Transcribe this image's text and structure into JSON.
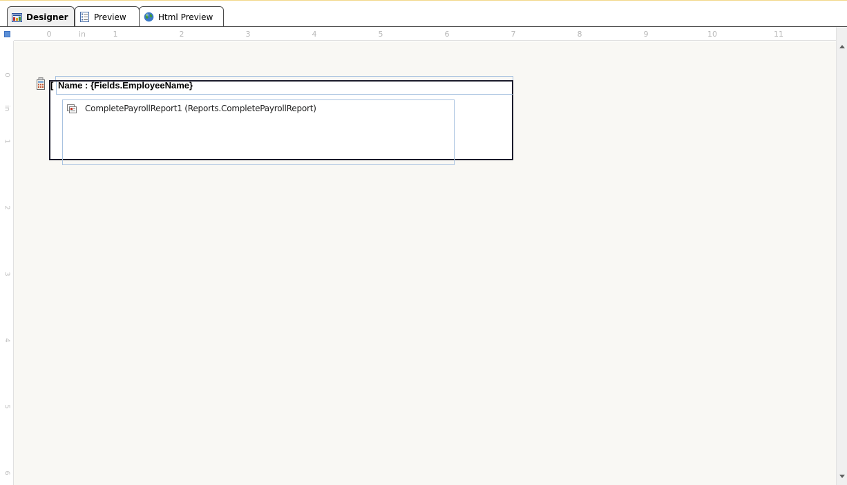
{
  "tabs": [
    {
      "label": "Designer",
      "icon": "designer-icon",
      "active": true
    },
    {
      "label": "Preview",
      "icon": "preview-icon",
      "active": false
    },
    {
      "label": "Html Preview",
      "icon": "globe-icon",
      "active": false
    }
  ],
  "ruler": {
    "unit": "in",
    "horizontal_labels": [
      "0",
      "1",
      "2",
      "3",
      "4",
      "5",
      "6",
      "7",
      "8",
      "9",
      "10",
      "11"
    ],
    "vertical_labels": [
      "0",
      "in",
      "1",
      "2",
      "3",
      "4",
      "5",
      "6"
    ]
  },
  "report": {
    "group_header_text": "Name : {Fields.EmployeeName}",
    "group_bracket": "[",
    "subreport_text": "CompletePayrollReport1 (Reports.CompletePayrollReport)"
  },
  "colors": {
    "accent": "#5b8fd6",
    "selection_outline": "#a8c2e0",
    "canvas_bg": "#f9f8f4"
  }
}
